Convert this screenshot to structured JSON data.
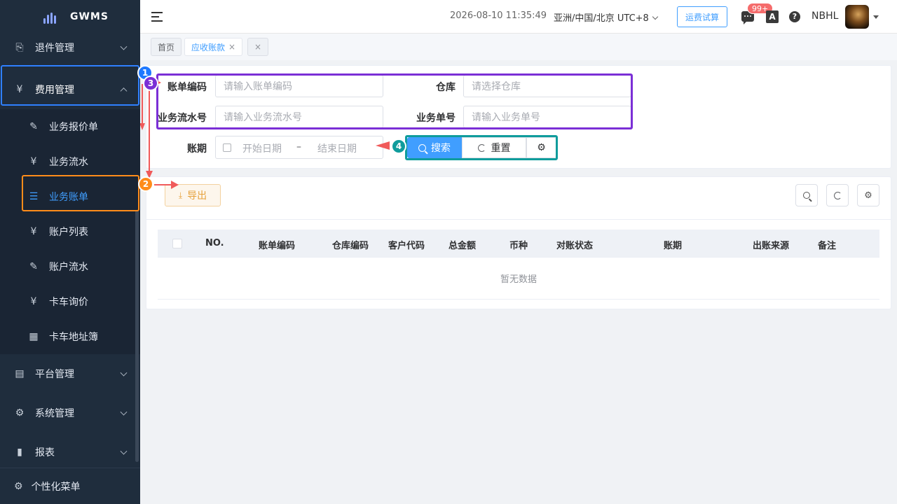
{
  "app": {
    "name": "GWMS"
  },
  "sidebar": {
    "items": [
      {
        "label": "退件管理",
        "icon": "return-icon"
      },
      {
        "label": "费用管理",
        "icon": "yen-icon",
        "expanded": true,
        "children": [
          {
            "label": "业务报价单",
            "icon": "edit-icon"
          },
          {
            "label": "业务流水",
            "icon": "yen-icon"
          },
          {
            "label": "业务账单",
            "icon": "list-icon",
            "active": true
          },
          {
            "label": "账户列表",
            "icon": "yen-icon"
          },
          {
            "label": "账户流水",
            "icon": "edit-icon"
          },
          {
            "label": "卡车询价",
            "icon": "yen-icon"
          },
          {
            "label": "卡车地址簿",
            "icon": "grid-icon"
          }
        ]
      },
      {
        "label": "平台管理",
        "icon": "shop-icon"
      },
      {
        "label": "系统管理",
        "icon": "gear-icon"
      },
      {
        "label": "报表",
        "icon": "bar-chart-icon"
      }
    ],
    "footer": {
      "label": "个性化菜单",
      "icon": "gear-icon"
    },
    "glyphs": {
      "yen": "¥",
      "list": "☰",
      "grid": "▦",
      "edit": "✎",
      "gear": "⚙"
    }
  },
  "header": {
    "datetime": "2026-08-10 11:35:49",
    "timezone": "亚洲/中国/北京 UTC+8",
    "freight_button": "运费试算",
    "message_badge": "99+",
    "lang_icon_text": "A",
    "help_text": "?",
    "username": "NBHL"
  },
  "tags": [
    {
      "label": "首页"
    },
    {
      "label": "应收账款",
      "active": true,
      "close": "×"
    },
    {
      "label": "",
      "close": "×"
    }
  ],
  "search": {
    "bill_code": {
      "label": "账单编码",
      "placeholder": "请输入账单编码"
    },
    "warehouse": {
      "label": "仓库",
      "placeholder": "请选择仓库"
    },
    "serial_no": {
      "label": "业务流水号",
      "placeholder": "请输入业务流水号"
    },
    "business_no": {
      "label": "业务单号",
      "placeholder": "请输入业务单号"
    },
    "period": {
      "label": "账期",
      "start_placeholder": "开始日期",
      "separator": "–",
      "end_placeholder": "结束日期"
    },
    "search_button": "搜索",
    "reset_button": "重置"
  },
  "toolbar": {
    "export_button": "导出",
    "export_icon": "⤓"
  },
  "table": {
    "columns": [
      "NO.",
      "账单编码",
      "仓库编码",
      "客户代码",
      "总金额",
      "币种",
      "对账状态",
      "账期",
      "出账来源",
      "备注"
    ],
    "rows": [],
    "empty_text": "暂无数据"
  },
  "annotations": [
    "1",
    "2",
    "3",
    "4"
  ],
  "colors": {
    "sidebar_bg": "#1f2d3d",
    "primary": "#409eff",
    "warning": "#e6a23c",
    "badge_blue": "#1e78ff",
    "badge_orange": "#ff8c1a",
    "badge_purple": "#7b2fd6",
    "badge_teal": "#0f9c9c"
  }
}
